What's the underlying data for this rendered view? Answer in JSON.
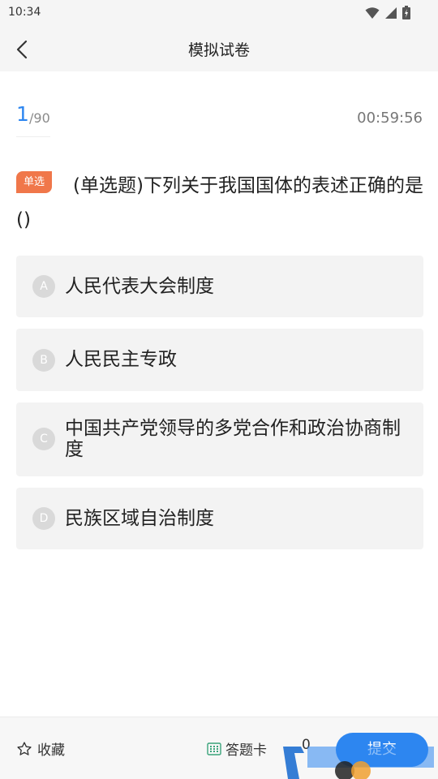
{
  "status_bar": {
    "time": "10:34"
  },
  "nav": {
    "title": "模拟试卷"
  },
  "progress": {
    "current": "1",
    "total": "/90",
    "timer": "00:59:56"
  },
  "question": {
    "badge": "单选",
    "text": "(单选题)下列关于我国国体的表述正确的是()"
  },
  "options": [
    {
      "letter": "A",
      "text": "人民代表大会制度"
    },
    {
      "letter": "B",
      "text": "人民民主专政"
    },
    {
      "letter": "C",
      "text": "中国共产党领导的多党合作和政治协商制度"
    },
    {
      "letter": "D",
      "text": "民族区域自治制度"
    }
  ],
  "bottom_bar": {
    "favorite_label": "收藏",
    "answer_card_label": "答题卡",
    "answer_count": "0",
    "submit_label": "提交"
  },
  "colors": {
    "accent": "#2d86f0",
    "badge": "#f0774a",
    "option_bg": "#f3f3f3"
  }
}
